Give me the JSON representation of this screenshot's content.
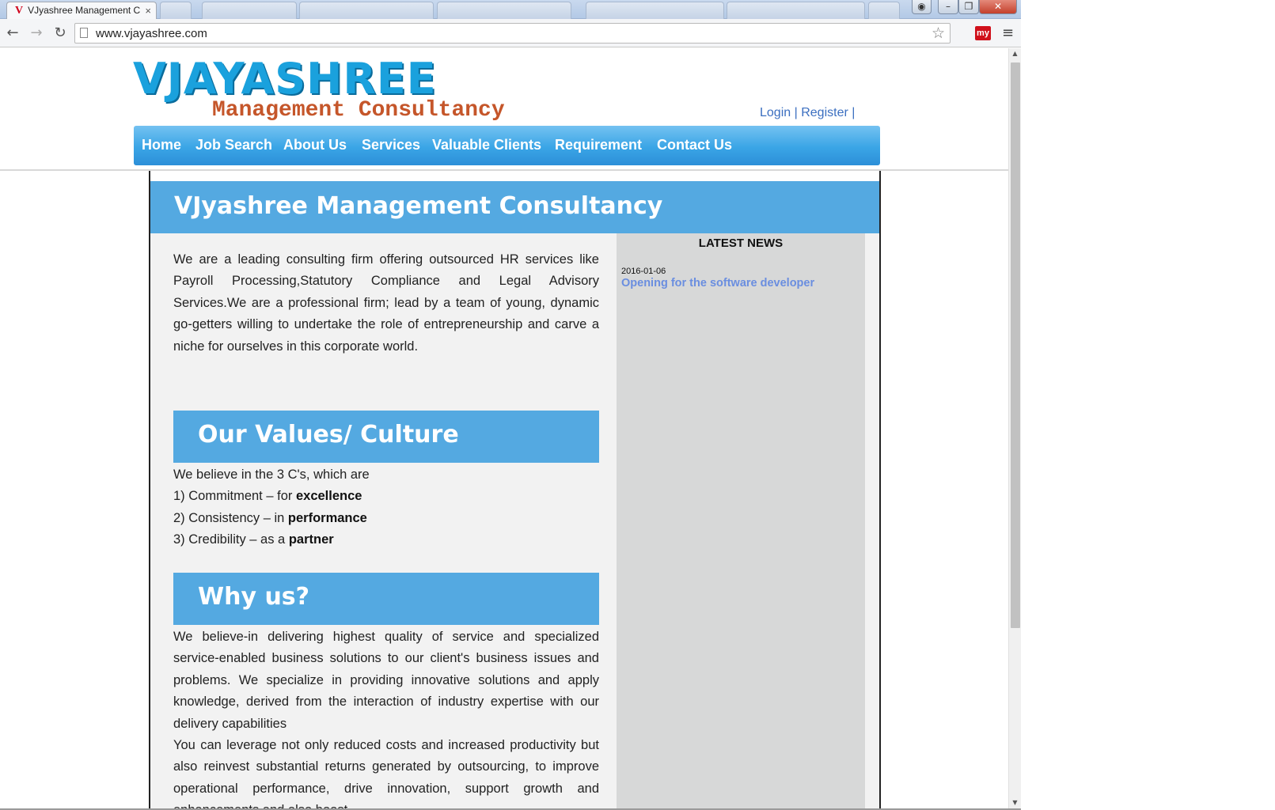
{
  "browser": {
    "active_tab": {
      "title": "VJyashree Management C",
      "favicon": "V",
      "close": "×"
    },
    "background_tabs": [
      "",
      "",
      "",
      "",
      "",
      "",
      ""
    ],
    "url": "www.vjayashree.com",
    "icons": {
      "back": "back-arrow-icon",
      "forward": "forward-arrow-icon",
      "reload": "reload-icon",
      "star": "bookmark-star-icon",
      "extension": "my",
      "menu": "hamburger-menu-icon"
    },
    "window_buttons": {
      "minimize": "–",
      "maximize": "❐",
      "close": "✕"
    }
  },
  "site": {
    "logo_main": "VJAYASHREE",
    "logo_sub": "Management Consultancy",
    "auth": {
      "login": "Login",
      "register": "Register",
      "sep": "|"
    },
    "nav": [
      "Home",
      "Job Search",
      "About Us",
      "Services",
      "Valuable Clients",
      "Requirement",
      "Contact Us"
    ],
    "colors": {
      "logo_blue": "#1aa1dd",
      "logo_orange": "#c5562a",
      "banner_blue": "#54a9e1",
      "link_blue": "#3b6fc0"
    }
  },
  "main": {
    "title": "VJyashree Management Consultancy",
    "intro": "We are a leading consulting firm offering outsourced HR services like Payroll Processing,Statutory Compliance and Legal Advisory Services.We are a professional firm; lead by a team of young, dynamic go-getters willing to undertake the role of entrepreneurship and carve a niche for ourselves in this corporate world.",
    "values": {
      "heading": "Our Values/ Culture",
      "lead": "We believe in the 3 C's, which are",
      "items": [
        {
          "text": "1) Commitment – for ",
          "bold": "excellence"
        },
        {
          "text": "2) Consistency – in ",
          "bold": "performance"
        },
        {
          "text": "3) Credibility – as a ",
          "bold": "partner"
        }
      ]
    },
    "why": {
      "heading": "Why us?",
      "p1": "We believe-in delivering highest quality of service and specialized service-enabled business solutions to our client's business issues and problems. We specialize in providing innovative solutions and apply knowledge, derived from the interaction of industry expertise with our delivery capabilities",
      "p2": "You can leverage not only reduced costs and increased productivity but also reinvest substantial returns generated by outsourcing, to improve operational performance, drive innovation, support growth and enhancements and also boost"
    }
  },
  "news": {
    "title": "LATEST NEWS",
    "items": [
      {
        "date": "2016-01-06",
        "headline": "Opening for the software developer"
      }
    ]
  }
}
